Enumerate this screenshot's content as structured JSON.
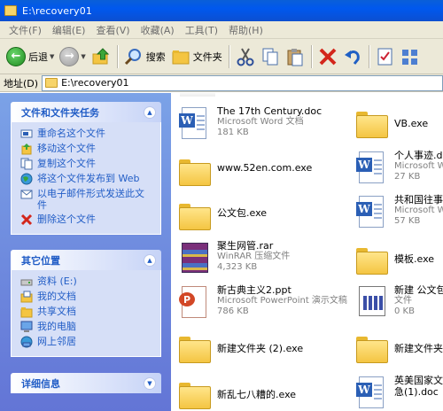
{
  "window": {
    "title": "E:\\recovery01"
  },
  "menu": [
    "文件(F)",
    "编辑(E)",
    "查看(V)",
    "收藏(A)",
    "工具(T)",
    "帮助(H)"
  ],
  "toolbar": {
    "back_label": "后退",
    "search_label": "搜索",
    "folders_label": "文件夹"
  },
  "address": {
    "label": "地址(D)",
    "value": "E:\\recovery01"
  },
  "sidebar": {
    "file_tasks": {
      "title": "文件和文件夹任务",
      "items": [
        "重命名这个文件",
        "移动这个文件",
        "复制这个文件",
        "将这个文件发布到 Web",
        "以电子邮件形式发送此文件",
        "删除这个文件"
      ]
    },
    "other_places": {
      "title": "其它位置",
      "items": [
        "资料 (E:)",
        "我的文档",
        "共享文档",
        "我的电脑",
        "网上邻居"
      ]
    },
    "details": {
      "title": "详细信息"
    }
  },
  "files": [
    {
      "name": "The 17th Century.doc",
      "type": "Microsoft Word 文档",
      "size": "181 KB",
      "icon": "word-doc-icon"
    },
    {
      "name": "VB.exe",
      "type": "",
      "size": "",
      "icon": "folder-icon"
    },
    {
      "name": "www.52en.com.exe",
      "type": "",
      "size": "",
      "icon": "folder-icon"
    },
    {
      "name": "个人事迹.doc",
      "type": "Microsoft Wo",
      "size": "27 KB",
      "icon": "word-doc-icon"
    },
    {
      "name": "公文包.exe",
      "type": "",
      "size": "",
      "icon": "folder-icon"
    },
    {
      "name": "共和国往事",
      "type": "Microsoft Wo",
      "size": "57 KB",
      "icon": "word-doc-icon"
    },
    {
      "name": "聚生网管.rar",
      "type": "WinRAR 压缩文件",
      "size": "4,323 KB",
      "icon": "winrar-icon"
    },
    {
      "name": "模板.exe",
      "type": "",
      "size": "",
      "icon": "folder-icon"
    },
    {
      "name": "新古典主义2.ppt",
      "type": "Microsoft PowerPoint 演示文稿",
      "size": "786 KB",
      "icon": "powerpoint-icon"
    },
    {
      "name": "新建 公文包",
      "type": "文件",
      "size": "0 KB",
      "icon": "briefcase-file-icon"
    },
    {
      "name": "新建文件夹 (2).exe",
      "type": "",
      "size": "",
      "icon": "folder-icon"
    },
    {
      "name": "新建文件夹",
      "type": "",
      "size": "",
      "icon": "folder-icon"
    },
    {
      "name": "新乱七八糟的.exe",
      "type": "",
      "size": "",
      "icon": "folder-icon"
    },
    {
      "name": "英美国家文",
      "type": "急(1).doc",
      "size": "",
      "icon": "word-doc-icon"
    }
  ]
}
